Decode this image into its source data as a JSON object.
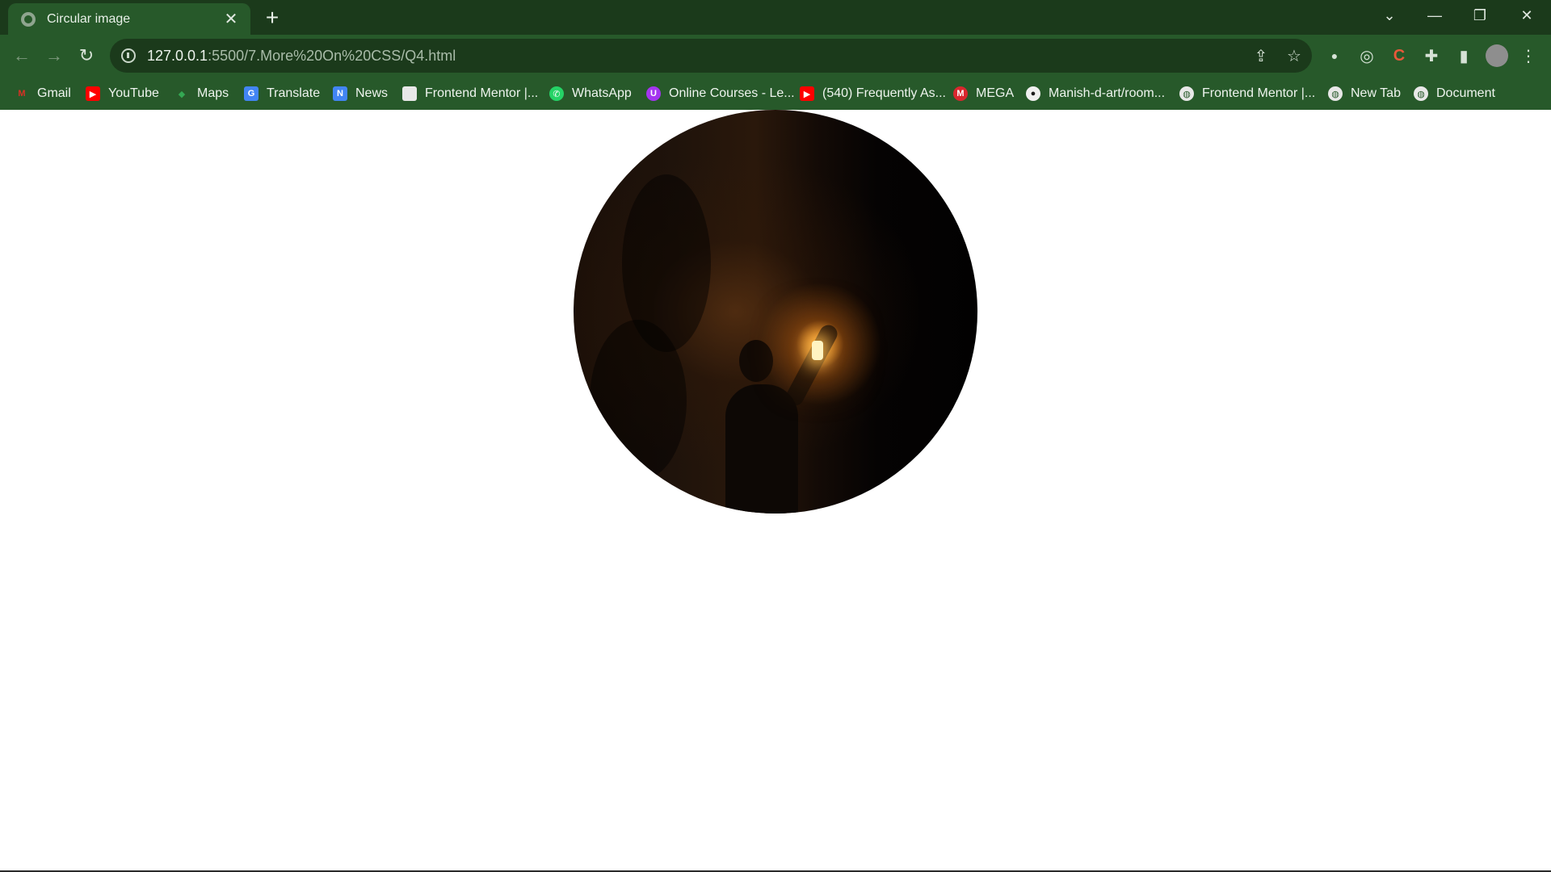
{
  "tab": {
    "title": "Circular image",
    "close": "✕"
  },
  "newtab": "+",
  "window_controls": {
    "tabs_menu": "⌄",
    "minimize": "—",
    "restore": "❐",
    "close": "✕"
  },
  "nav": {
    "back": "←",
    "forward": "→",
    "reload": "↻"
  },
  "omnibox": {
    "host": "127.0.0.1",
    "path": ":5500/7.More%20On%20CSS/Q4.html",
    "share": "⇪",
    "star": "☆"
  },
  "extensions": {
    "ext1": "●",
    "ext2": "◎",
    "ext3": "C",
    "puzzle": "✚",
    "sidepanel": "▮",
    "menu": "⋮"
  },
  "bookmarks": [
    {
      "label": "Gmail",
      "icon": "gmail-icon",
      "color": "#d93025",
      "glyph": "M"
    },
    {
      "label": "YouTube",
      "icon": "youtube-icon",
      "color": "#ff0000",
      "glyph": "▶"
    },
    {
      "label": "Maps",
      "icon": "maps-icon",
      "color": "#34a853",
      "glyph": "◆"
    },
    {
      "label": "Translate",
      "icon": "translate-icon",
      "color": "#4285f4",
      "glyph": "G"
    },
    {
      "label": "News",
      "icon": "news-icon",
      "color": "#4285f4",
      "glyph": "N"
    },
    {
      "label": "Frontend Mentor |...",
      "icon": "frontend-mentor-icon",
      "color": "#e8e8e8",
      "glyph": ""
    },
    {
      "label": "WhatsApp",
      "icon": "whatsapp-icon",
      "color": "#25d366",
      "glyph": "✆"
    },
    {
      "label": "Online Courses - Le...",
      "icon": "udemy-icon",
      "color": "#a435f0",
      "glyph": "U"
    },
    {
      "label": "(540) Frequently As...",
      "icon": "youtube-icon",
      "color": "#ff0000",
      "glyph": "▶"
    },
    {
      "label": "MEGA",
      "icon": "mega-icon",
      "color": "#d9272e",
      "glyph": "M"
    },
    {
      "label": "Manish-d-art/room...",
      "icon": "github-icon",
      "color": "#f0f0f0",
      "glyph": "●"
    },
    {
      "label": "Frontend Mentor |...",
      "icon": "globe-icon",
      "color": "#e8e8e8",
      "glyph": "◍"
    },
    {
      "label": "New Tab",
      "icon": "globe-icon",
      "color": "#e8e8e8",
      "glyph": "◍"
    },
    {
      "label": "Document",
      "icon": "globe-icon",
      "color": "#e8e8e8",
      "glyph": "◍"
    }
  ],
  "colors": {
    "frame": "#1b3a1b",
    "toolbar": "#27592a",
    "page": "#ffffff"
  }
}
